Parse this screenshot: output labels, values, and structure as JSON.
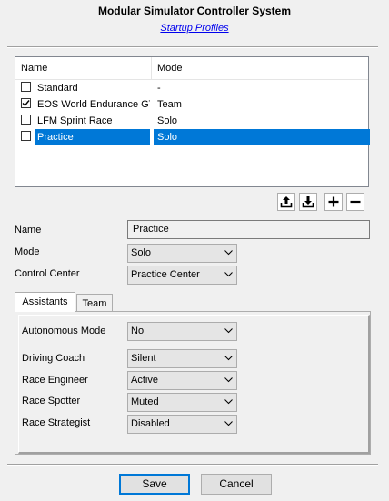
{
  "window": {
    "title": "Modular Simulator Controller System",
    "subtitle_link": "Startup Profiles"
  },
  "profiles": {
    "columns": [
      "Name",
      "Mode"
    ],
    "rows": [
      {
        "name": "Standard",
        "mode": "-",
        "checked": false,
        "selected": false
      },
      {
        "name": "EOS World Endurance GT",
        "mode": "Team",
        "checked": true,
        "selected": false
      },
      {
        "name": "LFM Sprint Race",
        "mode": "Solo",
        "checked": false,
        "selected": false
      },
      {
        "name": "Practice",
        "mode": "Solo",
        "checked": false,
        "selected": true
      }
    ]
  },
  "toolbar": {
    "icons": [
      "upload-icon",
      "download-icon",
      "plus-icon",
      "minus-icon"
    ]
  },
  "form": {
    "name_label": "Name",
    "name_value": "Practice",
    "mode_label": "Mode",
    "mode_value": "Solo",
    "control_center_label": "Control Center",
    "control_center_value": "Practice Center"
  },
  "tabs": {
    "items": [
      "Assistants",
      "Team"
    ],
    "active": "Assistants"
  },
  "assistants": [
    {
      "label": "Autonomous Mode",
      "value": "No"
    },
    {
      "label": "Driving Coach",
      "value": "Silent"
    },
    {
      "label": "Race Engineer",
      "value": "Active"
    },
    {
      "label": "Race Spotter",
      "value": "Muted"
    },
    {
      "label": "Race Strategist",
      "value": "Disabled"
    }
  ],
  "buttons": {
    "save": "Save",
    "cancel": "Cancel"
  },
  "colors": {
    "selection": "#0078d7",
    "link": "#0000ee"
  }
}
